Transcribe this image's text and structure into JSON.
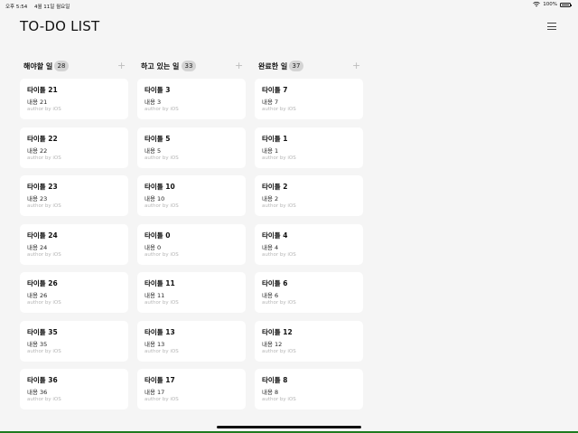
{
  "status": {
    "time": "오후 5:54",
    "date": "4월 11일 월요일",
    "battery_text": "100%",
    "battery_level": 1.0
  },
  "app": {
    "title": "TO-DO LIST"
  },
  "columns": [
    {
      "title": "해야할 일",
      "count": "28",
      "cards": [
        {
          "title": "타이틀 21",
          "content": "내용 21",
          "author": "author by iOS"
        },
        {
          "title": "타이틀 22",
          "content": "내용 22",
          "author": "author by iOS"
        },
        {
          "title": "타이틀 23",
          "content": "내용 23",
          "author": "author by iOS"
        },
        {
          "title": "타이틀 24",
          "content": "내용 24",
          "author": "author by iOS"
        },
        {
          "title": "타이틀 26",
          "content": "내용 26",
          "author": "author by iOS"
        },
        {
          "title": "타이틀 35",
          "content": "내용 35",
          "author": "author by iOS"
        },
        {
          "title": "타이틀 36",
          "content": "내용 36",
          "author": "author by iOS"
        }
      ]
    },
    {
      "title": "하고 있는 일",
      "count": "33",
      "cards": [
        {
          "title": "타이틀 3",
          "content": "내용 3",
          "author": "author by iOS"
        },
        {
          "title": "타이틀 5",
          "content": "내용 5",
          "author": "author by iOS"
        },
        {
          "title": "타이틀 10",
          "content": "내용 10",
          "author": "author by iOS"
        },
        {
          "title": "타이틀 0",
          "content": "내용 0",
          "author": "author by iOS"
        },
        {
          "title": "타이틀 11",
          "content": "내용 11",
          "author": "author by iOS"
        },
        {
          "title": "타이틀 13",
          "content": "내용 13",
          "author": "author by iOS"
        },
        {
          "title": "타이틀 17",
          "content": "내용 17",
          "author": "author by iOS"
        }
      ]
    },
    {
      "title": "완료한 일",
      "count": "37",
      "cards": [
        {
          "title": "타이틀 7",
          "content": "내용 7",
          "author": "author by iOS"
        },
        {
          "title": "타이틀 1",
          "content": "내용 1",
          "author": "author by iOS"
        },
        {
          "title": "타이틀 2",
          "content": "내용 2",
          "author": "author by iOS"
        },
        {
          "title": "타이틀 4",
          "content": "내용 4",
          "author": "author by iOS"
        },
        {
          "title": "타이틀 6",
          "content": "내용 6",
          "author": "author by iOS"
        },
        {
          "title": "타이틀 12",
          "content": "내용 12",
          "author": "author by iOS"
        },
        {
          "title": "타이틀 8",
          "content": "내용 8",
          "author": "author by iOS"
        }
      ]
    }
  ],
  "icons": {
    "menu": "hamburger-menu-icon",
    "add": "plus-icon",
    "wifi": "wifi-icon",
    "battery": "battery-icon"
  },
  "colors": {
    "background": "#f5f5f5",
    "card": "#ffffff",
    "badge": "#d4d4d4",
    "muted_text": "#b5b5b5"
  }
}
